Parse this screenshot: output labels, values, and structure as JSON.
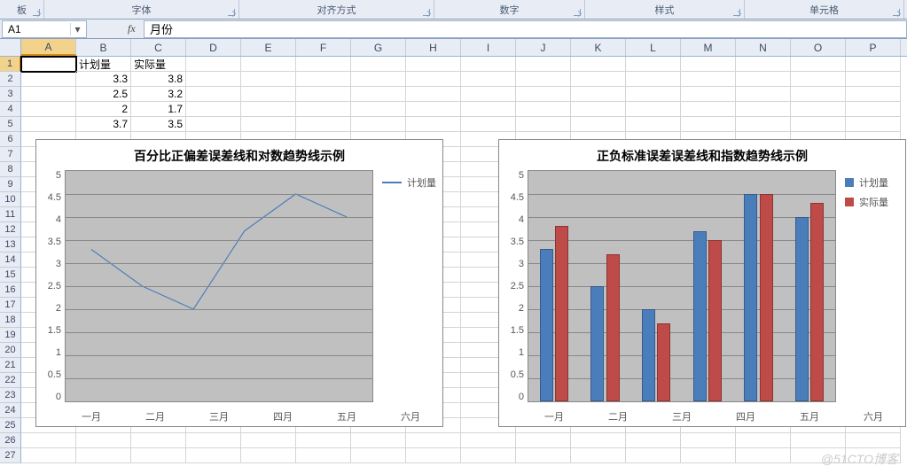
{
  "ribbon": {
    "groups": [
      "板",
      "字体",
      "对齐方式",
      "数字",
      "样式",
      "单元格"
    ],
    "widths": [
      50,
      220,
      220,
      170,
      180,
      180
    ]
  },
  "name_box": {
    "value": "A1"
  },
  "formula": {
    "fx": "fx",
    "value": "月份"
  },
  "columns": [
    "A",
    "B",
    "C",
    "D",
    "E",
    "F",
    "G",
    "H",
    "I",
    "J",
    "K",
    "L",
    "M",
    "N",
    "O",
    "P"
  ],
  "rows": [
    "1",
    "2",
    "3",
    "4",
    "5"
  ],
  "cells": {
    "B1": "计划量",
    "C1": "实际量",
    "B2": "3.3",
    "C2": "3.8",
    "B3": "2.5",
    "C3": "3.2",
    "B4": "2",
    "C4": "1.7",
    "B5": "3.7",
    "C5": "3.5"
  },
  "chart_data": [
    {
      "type": "line",
      "title": "百分比正偏差误差线和对数趋势线示例",
      "categories": [
        "一月",
        "二月",
        "三月",
        "四月",
        "五月",
        "六月"
      ],
      "series": [
        {
          "name": "计划量",
          "values": [
            3.3,
            2.5,
            2.0,
            3.7,
            4.5,
            4.0
          ],
          "color": "#4a7ebb"
        }
      ],
      "y_ticks": [
        "5",
        "4.5",
        "4",
        "3.5",
        "3",
        "2.5",
        "2",
        "1.5",
        "1",
        "0.5",
        "0"
      ],
      "ylim": [
        0,
        5
      ]
    },
    {
      "type": "bar",
      "title": "正负标准误差误差线和指数趋势线示例",
      "categories": [
        "一月",
        "二月",
        "三月",
        "四月",
        "五月",
        "六月"
      ],
      "series": [
        {
          "name": "计划量",
          "values": [
            3.3,
            2.5,
            2.0,
            3.7,
            4.5,
            4.0
          ],
          "color": "#4a7ebb"
        },
        {
          "name": "实际量",
          "values": [
            3.8,
            3.2,
            1.7,
            3.5,
            4.5,
            4.3
          ],
          "color": "#be4b48"
        }
      ],
      "y_ticks": [
        "5",
        "4.5",
        "4",
        "3.5",
        "3",
        "2.5",
        "2",
        "1.5",
        "1",
        "0.5",
        "0"
      ],
      "ylim": [
        0,
        5
      ]
    }
  ],
  "watermark": "@51CTO博客"
}
